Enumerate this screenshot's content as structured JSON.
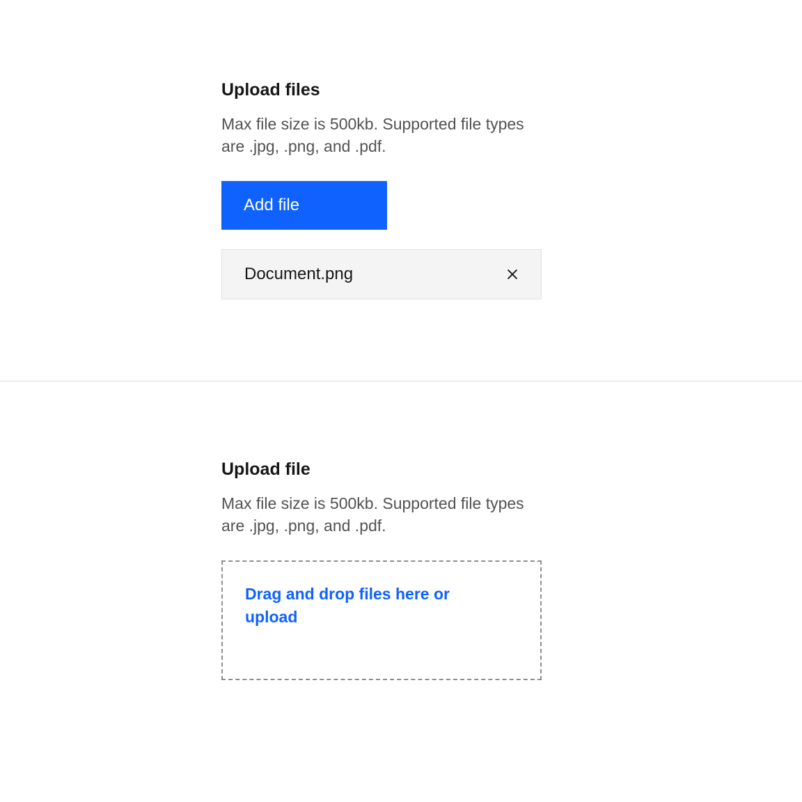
{
  "section1": {
    "heading": "Upload files",
    "description": "Max file size is 500kb. Supported file types are .jpg, .png, and .pdf.",
    "addFileLabel": "Add file",
    "files": [
      {
        "name": "Document.png"
      }
    ]
  },
  "section2": {
    "heading": "Upload file",
    "description": "Max file size is 500kb. Supported file types are .jpg, .png, and .pdf.",
    "dropText": "Drag and drop files here or upload"
  }
}
